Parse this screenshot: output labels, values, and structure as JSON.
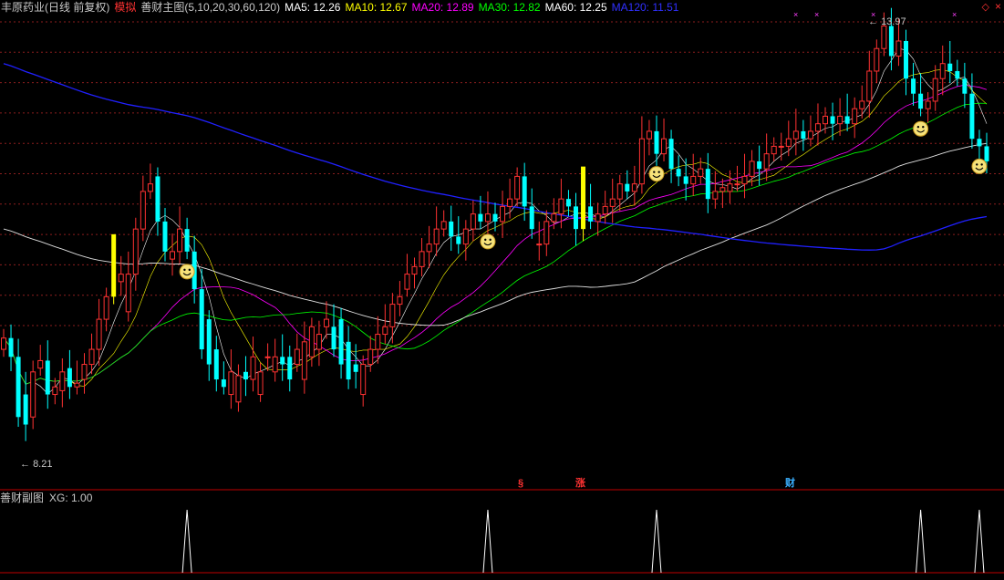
{
  "header": {
    "stock_name": "丰原药业(日线 前复权)",
    "mode": "模拟",
    "indicator": "善财主图(5,10,20,30,60,120)",
    "ma": [
      {
        "label": "MA5: 12.26",
        "color": "#ffffff"
      },
      {
        "label": "MA10: 12.67",
        "color": "#ffff00"
      },
      {
        "label": "MA20: 12.89",
        "color": "#ff00ff"
      },
      {
        "label": "MA30: 12.82",
        "color": "#00ff00"
      },
      {
        "label": "MA60: 12.25",
        "color": "#ffffff"
      },
      {
        "label": "MA120: 11.51",
        "color": "#3030ff"
      }
    ]
  },
  "sub": {
    "title": "善财副图",
    "value": "XG: 1.00"
  },
  "markers": {
    "high": "13.97",
    "low": "8.21",
    "tag_s": "§",
    "tag_zhang": "涨",
    "tag_cai": "财"
  },
  "colors": {
    "up": "#ff3232",
    "down": "#00ffff",
    "signal": "#ffff00",
    "grid": "#8c1e1e",
    "divider": "#c00000"
  },
  "chart_data": {
    "type": "candlestick",
    "x": "trading days (index 0-134)",
    "ohlc_open": [
      9.6,
      9.75,
      9.5,
      9.0,
      8.7,
      9.35,
      9.45,
      9.0,
      9.05,
      9.35,
      9.1,
      9.2,
      9.4,
      9.6,
      10.0,
      10.3,
      10.5,
      10.1,
      10.6,
      11.2,
      11.7,
      11.9,
      11.3,
      10.8,
      10.9,
      11.2,
      10.9,
      10.4,
      10.0,
      9.6,
      9.2,
      9.0,
      8.9,
      9.3,
      9.2,
      9.0,
      9.5,
      9.3,
      9.5,
      9.5,
      9.4,
      9.2,
      9.5,
      9.6,
      9.9,
      9.9,
      10.0,
      9.7,
      9.4,
      9.0,
      9.4,
      9.6,
      9.8,
      9.9,
      10.2,
      10.4,
      10.6,
      10.7,
      10.9,
      11.0,
      11.2,
      11.3,
      11.1,
      11.0,
      11.2,
      11.4,
      11.3,
      11.4,
      11.3,
      11.5,
      11.6,
      11.9,
      11.5,
      11.0,
      11.0,
      11.3,
      11.4,
      11.6,
      11.5,
      11.2,
      11.5,
      11.3,
      11.4,
      11.5,
      11.6,
      11.8,
      11.7,
      11.8,
      12.4,
      12.5,
      12.2,
      12.4,
      12.0,
      11.9,
      11.8,
      11.9,
      12.0,
      11.6,
      11.7,
      11.7,
      11.8,
      11.8,
      11.9,
      12.1,
      12.0,
      12.2,
      12.3,
      12.3,
      12.4,
      12.5,
      12.4,
      12.5,
      12.6,
      12.7,
      12.6,
      12.7,
      12.6,
      12.8,
      12.9,
      13.3,
      13.6,
      13.9,
      13.5,
      13.7,
      13.2,
      13.0,
      12.8,
      12.9,
      13.2,
      13.4,
      13.3,
      13.2,
      13.0,
      12.4,
      12.3
    ],
    "ohlc_close": [
      9.75,
      9.5,
      8.7,
      8.6,
      9.3,
      9.45,
      9.0,
      9.1,
      9.3,
      9.1,
      9.15,
      9.4,
      9.6,
      10.0,
      10.3,
      10.5,
      10.6,
      10.6,
      11.2,
      11.7,
      11.8,
      11.3,
      10.9,
      10.9,
      11.2,
      10.9,
      10.4,
      9.6,
      9.4,
      9.2,
      9.1,
      9.3,
      9.25,
      9.2,
      9.5,
      9.3,
      9.5,
      9.5,
      9.4,
      9.2,
      9.6,
      9.7,
      9.9,
      9.8,
      10.0,
      9.6,
      9.4,
      9.2,
      9.3,
      9.4,
      9.6,
      9.8,
      9.9,
      10.2,
      10.3,
      10.6,
      10.7,
      10.9,
      11.0,
      11.2,
      11.3,
      11.1,
      11.0,
      11.2,
      11.4,
      11.3,
      11.4,
      11.3,
      11.5,
      11.6,
      11.9,
      11.5,
      11.2,
      11.0,
      11.3,
      11.4,
      11.6,
      11.5,
      11.2,
      11.4,
      11.3,
      11.4,
      11.5,
      11.6,
      11.8,
      11.7,
      11.8,
      12.4,
      12.5,
      12.2,
      12.4,
      12.0,
      11.9,
      11.8,
      11.9,
      12.0,
      11.6,
      11.7,
      11.75,
      11.8,
      11.8,
      11.9,
      12.1,
      12.0,
      12.2,
      12.3,
      12.3,
      12.4,
      12.5,
      12.4,
      12.5,
      12.6,
      12.7,
      12.6,
      12.7,
      12.6,
      12.8,
      12.9,
      13.3,
      13.6,
      13.9,
      13.5,
      13.7,
      13.2,
      13.0,
      12.8,
      12.9,
      13.2,
      13.4,
      13.3,
      13.2,
      13.0,
      12.4,
      12.3,
      12.1
    ],
    "low": 8.21,
    "high": 13.97,
    "ma_series": [
      "MA5",
      "MA10",
      "MA20",
      "MA30",
      "MA60",
      "MA120"
    ],
    "signal_days": [
      15,
      79
    ],
    "smiley_days": [
      25,
      66,
      89,
      125,
      133
    ],
    "sub_xg_spike_days": [
      25,
      66,
      89,
      125,
      133
    ],
    "ylim": [
      8.0,
      14.1
    ]
  }
}
